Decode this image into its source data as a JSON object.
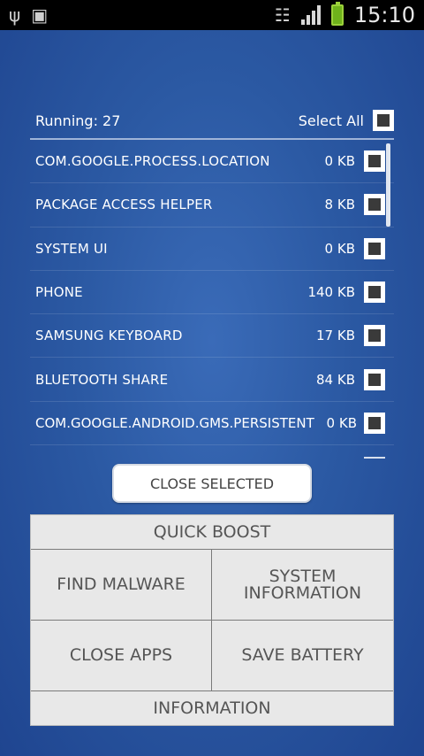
{
  "status_bar": {
    "time": "15:10",
    "icons": [
      "usb-icon",
      "sim-icon",
      "wifi-icon",
      "signal-icon",
      "battery-charging-icon"
    ]
  },
  "header": {
    "running_label": "Running: 27",
    "select_all_label": "Select All"
  },
  "processes": [
    {
      "name": "COM.GOOGLE.PROCESS.LOCATION",
      "size": "0 KB"
    },
    {
      "name": "PACKAGE ACCESS HELPER",
      "size": "8 KB"
    },
    {
      "name": "SYSTEM UI",
      "size": "0 KB"
    },
    {
      "name": "PHONE",
      "size": "140 KB"
    },
    {
      "name": "SAMSUNG KEYBOARD",
      "size": "17 KB"
    },
    {
      "name": "BLUETOOTH SHARE",
      "size": "84 KB"
    },
    {
      "name": "COM.GOOGLE.ANDROID.GMS.PERSISTENT",
      "size": "0 KB"
    }
  ],
  "close_selected_label": "CLOSE SELECTED",
  "menu": {
    "quick_boost": "QUICK BOOST",
    "find_malware": "FIND MALWARE",
    "system_information": "SYSTEM\nINFORMATION",
    "close_apps": "CLOSE APPS",
    "save_battery": "SAVE BATTERY",
    "information": "INFORMATION"
  },
  "colors": {
    "background": "#2b59a3",
    "menu_background": "#e8e8e8"
  }
}
